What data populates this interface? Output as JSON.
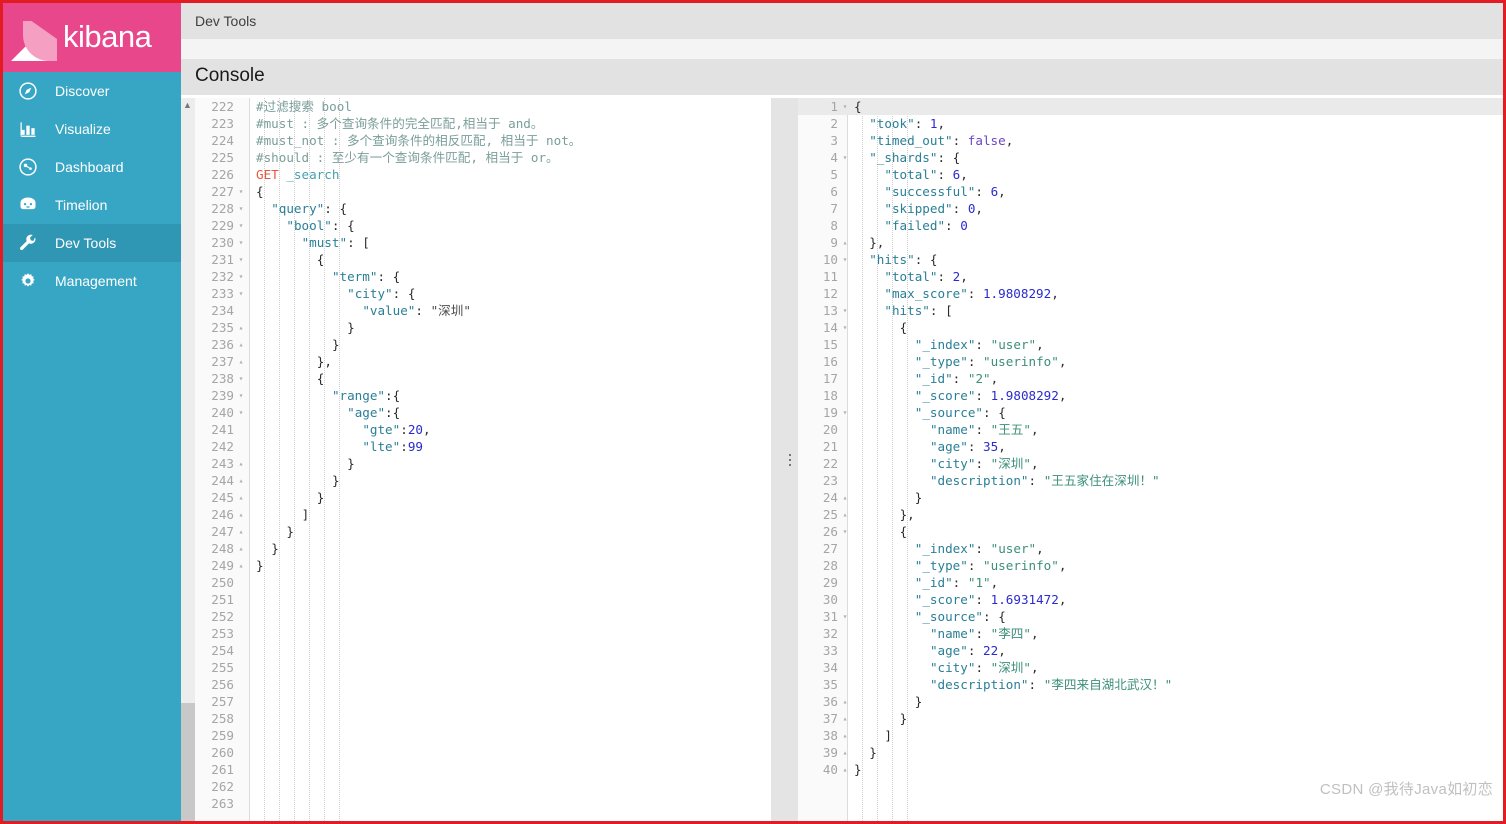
{
  "app": {
    "brand_name": "kibana",
    "accent_pink": "#e8488b",
    "sidebar_bg": "#37a6c4",
    "sidebar_active_bg": "#2f96b4",
    "frame_border_color": "#e31b23"
  },
  "sidebar": {
    "items": [
      {
        "label": "Discover",
        "icon": "compass-icon",
        "active": false
      },
      {
        "label": "Visualize",
        "icon": "bar-chart-icon",
        "active": false
      },
      {
        "label": "Dashboard",
        "icon": "dashboard-icon",
        "active": false
      },
      {
        "label": "Timelion",
        "icon": "timelion-icon",
        "active": false
      },
      {
        "label": "Dev Tools",
        "icon": "wrench-icon",
        "active": true
      },
      {
        "label": "Management",
        "icon": "gear-icon",
        "active": false
      }
    ]
  },
  "header": {
    "app_title": "Dev Tools",
    "console_tab": "Console"
  },
  "watermark": "CSDN @我待Java如初恋",
  "request_editor": {
    "first_line_number": 222,
    "last_line_number": 263,
    "lines": [
      {
        "n": 222,
        "fold": "",
        "text": "#过滤搜索 bool",
        "tok": "comment"
      },
      {
        "n": 223,
        "fold": "",
        "text": "#must : 多个查询条件的完全匹配,相当于 and。",
        "tok": "comment"
      },
      {
        "n": 224,
        "fold": "",
        "text": "#must_not : 多个查询条件的相反匹配, 相当于 not。",
        "tok": "comment"
      },
      {
        "n": 225,
        "fold": "",
        "text": "#should : 至少有一个查询条件匹配, 相当于 or。",
        "tok": "comment"
      },
      {
        "n": 226,
        "fold": "",
        "text": "GET _search",
        "tok": "request"
      },
      {
        "n": 227,
        "fold": "▾",
        "text": "{",
        "tok": "code"
      },
      {
        "n": 228,
        "fold": "▾",
        "text": "  \"query\": {",
        "tok": "code"
      },
      {
        "n": 229,
        "fold": "▾",
        "text": "    \"bool\": {",
        "tok": "code"
      },
      {
        "n": 230,
        "fold": "▾",
        "text": "      \"must\": [",
        "tok": "code"
      },
      {
        "n": 231,
        "fold": "▾",
        "text": "        {",
        "tok": "code"
      },
      {
        "n": 232,
        "fold": "▾",
        "text": "          \"term\": {",
        "tok": "code"
      },
      {
        "n": 233,
        "fold": "▾",
        "text": "            \"city\": {",
        "tok": "code"
      },
      {
        "n": 234,
        "fold": "",
        "text": "              \"value\": \"深圳\"",
        "tok": "code"
      },
      {
        "n": 235,
        "fold": "▴",
        "text": "            }",
        "tok": "code"
      },
      {
        "n": 236,
        "fold": "▴",
        "text": "          }",
        "tok": "code"
      },
      {
        "n": 237,
        "fold": "▴",
        "text": "        },",
        "tok": "code"
      },
      {
        "n": 238,
        "fold": "▾",
        "text": "        {",
        "tok": "code"
      },
      {
        "n": 239,
        "fold": "▾",
        "text": "          \"range\":{",
        "tok": "code"
      },
      {
        "n": 240,
        "fold": "▾",
        "text": "            \"age\":{",
        "tok": "code"
      },
      {
        "n": 241,
        "fold": "",
        "text": "              \"gte\":20,",
        "tok": "code"
      },
      {
        "n": 242,
        "fold": "",
        "text": "              \"lte\":99",
        "tok": "code"
      },
      {
        "n": 243,
        "fold": "▴",
        "text": "            }",
        "tok": "code"
      },
      {
        "n": 244,
        "fold": "▴",
        "text": "          }",
        "tok": "code"
      },
      {
        "n": 245,
        "fold": "▴",
        "text": "        }",
        "tok": "code"
      },
      {
        "n": 246,
        "fold": "▴",
        "text": "      ]",
        "tok": "code"
      },
      {
        "n": 247,
        "fold": "▴",
        "text": "    }",
        "tok": "code"
      },
      {
        "n": 248,
        "fold": "▴",
        "text": "  }",
        "tok": "code"
      },
      {
        "n": 249,
        "fold": "▴",
        "text": "}",
        "tok": "code"
      },
      {
        "n": 250,
        "fold": "",
        "text": "",
        "tok": "code"
      },
      {
        "n": 251,
        "fold": "",
        "text": "",
        "tok": "code"
      },
      {
        "n": 252,
        "fold": "",
        "text": "",
        "tok": "code"
      },
      {
        "n": 253,
        "fold": "",
        "text": "",
        "tok": "code"
      },
      {
        "n": 254,
        "fold": "",
        "text": "",
        "tok": "code"
      },
      {
        "n": 255,
        "fold": "",
        "text": "",
        "tok": "code"
      },
      {
        "n": 256,
        "fold": "",
        "text": "",
        "tok": "code"
      },
      {
        "n": 257,
        "fold": "",
        "text": "",
        "tok": "code"
      },
      {
        "n": 258,
        "fold": "",
        "text": "",
        "tok": "code"
      },
      {
        "n": 259,
        "fold": "",
        "text": "",
        "tok": "code"
      },
      {
        "n": 260,
        "fold": "",
        "text": "",
        "tok": "code"
      },
      {
        "n": 261,
        "fold": "",
        "text": "",
        "tok": "code"
      },
      {
        "n": 262,
        "fold": "",
        "text": "",
        "tok": "code"
      },
      {
        "n": 263,
        "fold": "",
        "text": "",
        "tok": "code"
      }
    ]
  },
  "response_editor": {
    "first_line_number": 1,
    "last_line_number": 40,
    "lines": [
      {
        "n": 1,
        "fold": "▾",
        "text": "{",
        "hl": true
      },
      {
        "n": 2,
        "fold": "",
        "text": "  \"took\": 1,"
      },
      {
        "n": 3,
        "fold": "",
        "text": "  \"timed_out\": false,"
      },
      {
        "n": 4,
        "fold": "▾",
        "text": "  \"_shards\": {"
      },
      {
        "n": 5,
        "fold": "",
        "text": "    \"total\": 6,"
      },
      {
        "n": 6,
        "fold": "",
        "text": "    \"successful\": 6,"
      },
      {
        "n": 7,
        "fold": "",
        "text": "    \"skipped\": 0,"
      },
      {
        "n": 8,
        "fold": "",
        "text": "    \"failed\": 0"
      },
      {
        "n": 9,
        "fold": "▴",
        "text": "  },"
      },
      {
        "n": 10,
        "fold": "▾",
        "text": "  \"hits\": {"
      },
      {
        "n": 11,
        "fold": "",
        "text": "    \"total\": 2,"
      },
      {
        "n": 12,
        "fold": "",
        "text": "    \"max_score\": 1.9808292,"
      },
      {
        "n": 13,
        "fold": "▾",
        "text": "    \"hits\": ["
      },
      {
        "n": 14,
        "fold": "▾",
        "text": "      {"
      },
      {
        "n": 15,
        "fold": "",
        "text": "        \"_index\": \"user\","
      },
      {
        "n": 16,
        "fold": "",
        "text": "        \"_type\": \"userinfo\","
      },
      {
        "n": 17,
        "fold": "",
        "text": "        \"_id\": \"2\","
      },
      {
        "n": 18,
        "fold": "",
        "text": "        \"_score\": 1.9808292,"
      },
      {
        "n": 19,
        "fold": "▾",
        "text": "        \"_source\": {"
      },
      {
        "n": 20,
        "fold": "",
        "text": "          \"name\": \"王五\","
      },
      {
        "n": 21,
        "fold": "",
        "text": "          \"age\": 35,"
      },
      {
        "n": 22,
        "fold": "",
        "text": "          \"city\": \"深圳\","
      },
      {
        "n": 23,
        "fold": "",
        "text": "          \"description\": \"王五家住在深圳！\""
      },
      {
        "n": 24,
        "fold": "▴",
        "text": "        }"
      },
      {
        "n": 25,
        "fold": "▴",
        "text": "      },"
      },
      {
        "n": 26,
        "fold": "▾",
        "text": "      {"
      },
      {
        "n": 27,
        "fold": "",
        "text": "        \"_index\": \"user\","
      },
      {
        "n": 28,
        "fold": "",
        "text": "        \"_type\": \"userinfo\","
      },
      {
        "n": 29,
        "fold": "",
        "text": "        \"_id\": \"1\","
      },
      {
        "n": 30,
        "fold": "",
        "text": "        \"_score\": 1.6931472,"
      },
      {
        "n": 31,
        "fold": "▾",
        "text": "        \"_source\": {"
      },
      {
        "n": 32,
        "fold": "",
        "text": "          \"name\": \"李四\","
      },
      {
        "n": 33,
        "fold": "",
        "text": "          \"age\": 22,"
      },
      {
        "n": 34,
        "fold": "",
        "text": "          \"city\": \"深圳\","
      },
      {
        "n": 35,
        "fold": "",
        "text": "          \"description\": \"李四来自湖北武汉！\""
      },
      {
        "n": 36,
        "fold": "▴",
        "text": "        }"
      },
      {
        "n": 37,
        "fold": "▴",
        "text": "      }"
      },
      {
        "n": 38,
        "fold": "▴",
        "text": "    ]"
      },
      {
        "n": 39,
        "fold": "▴",
        "text": "  }"
      },
      {
        "n": 40,
        "fold": "▴",
        "text": "}"
      }
    ]
  }
}
